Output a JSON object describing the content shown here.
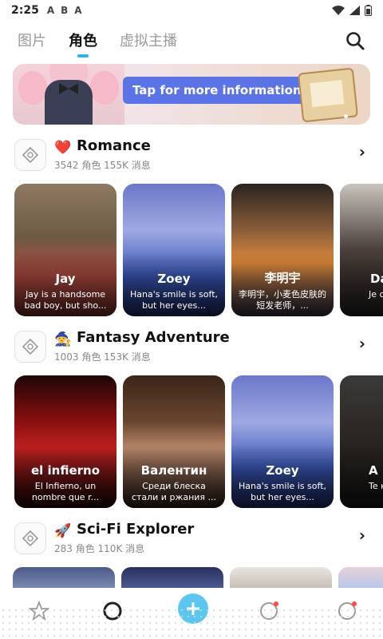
{
  "status_bar": {
    "time": "2:25",
    "icons": [
      "A",
      "B",
      "A"
    ]
  },
  "top_tabs": {
    "tabs": [
      "图片",
      "角色",
      "虚拟主播"
    ],
    "active_index": 1
  },
  "banner": {
    "button_label": "Tap for more information ›"
  },
  "sections": [
    {
      "emoji": "❤️",
      "title": "Romance",
      "subtitle": "3542 角色 155K 消息",
      "cards": [
        {
          "name": "Jay",
          "desc": "Jay is a handsome bad boy, but sho..."
        },
        {
          "name": "Zoey",
          "desc": "Hana's smile is soft, but her eyes..."
        },
        {
          "name": "李明宇",
          "desc": "李明宇，小麦色皮肤的短发老师，..."
        },
        {
          "name": "Da",
          "desc": "Je c l'a"
        }
      ]
    },
    {
      "emoji": "🧙",
      "title": "Fantasy Adventure",
      "subtitle": "1003 角色 153K 消息",
      "cards": [
        {
          "name": "el infierno",
          "desc": "El Infierno, un nombre que r..."
        },
        {
          "name": "Валентин",
          "desc": "Среди блеска стали и ржания ..."
        },
        {
          "name": "Zoey",
          "desc": "Hana's smile is soft, but her eyes..."
        },
        {
          "name": "A",
          "desc": "Te костюм"
        }
      ]
    },
    {
      "emoji": "🚀",
      "title": "Sci-Fi Explorer",
      "subtitle": "283 角色 110K 消息",
      "cards": []
    }
  ],
  "colors": {
    "accent": "#22b8ee",
    "banner_button": "#5a74e8"
  },
  "icons": {
    "search": "search-icon",
    "chevron": "chevron-right-icon",
    "category": "category-icon"
  }
}
